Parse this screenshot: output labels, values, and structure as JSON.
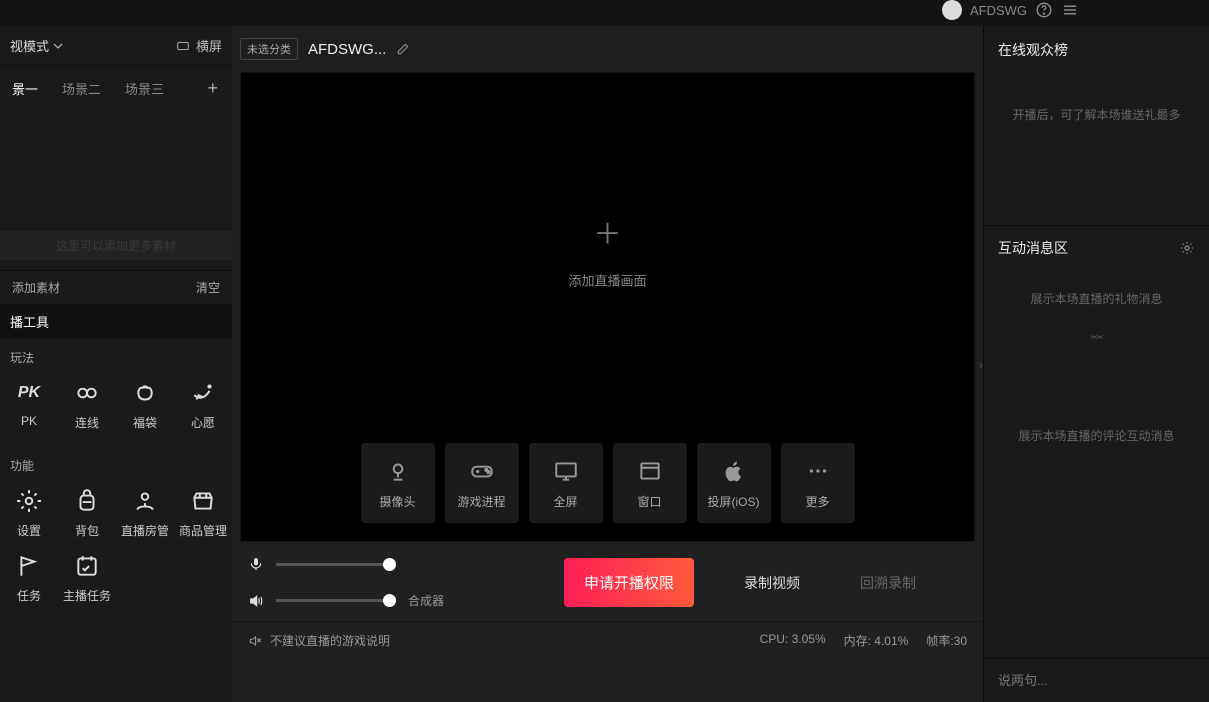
{
  "topbar": {
    "username": "AFDSWG"
  },
  "sidebar": {
    "mode_label": "视模式",
    "orientation_label": "横屏",
    "scenes": [
      "景一",
      "场景二",
      "场景三"
    ],
    "material_hint": "这里可以添加更多素材",
    "add_material_label": "添加素材",
    "clear_label": "清空",
    "tools_header": "播工具",
    "gameplay_header": "玩法",
    "gameplay": [
      {
        "id": "pk",
        "label": "PK"
      },
      {
        "id": "link",
        "label": "连线"
      },
      {
        "id": "lucky",
        "label": "福袋"
      },
      {
        "id": "wish",
        "label": "心愿"
      }
    ],
    "features_header": "功能",
    "features": [
      {
        "id": "settings",
        "label": "设置"
      },
      {
        "id": "backpack",
        "label": "背包"
      },
      {
        "id": "room-admin",
        "label": "直播房管"
      },
      {
        "id": "goods",
        "label": "商品管理"
      },
      {
        "id": "task1",
        "label": "任务"
      },
      {
        "id": "host-task",
        "label": "主播任务"
      }
    ]
  },
  "middle": {
    "category_tag": "未选分类",
    "title": "AFDSWG...",
    "add_preview_label": "添加直播画面",
    "sources": [
      {
        "id": "camera",
        "label": "摄像头"
      },
      {
        "id": "game",
        "label": "游戏进程"
      },
      {
        "id": "fullscreen",
        "label": "全屏"
      },
      {
        "id": "window",
        "label": "窗口"
      },
      {
        "id": "ios",
        "label": "投屏(iOS)"
      },
      {
        "id": "more",
        "label": "更多"
      }
    ],
    "synth_label": "合成器",
    "start_button": "申请开播权限",
    "record_label": "录制视频",
    "replay_label": "回溯录制",
    "advice_label": "不建议直播的游戏说明",
    "cpu_label": "CPU: 3.05%",
    "mem_label": "内存: 4.01%",
    "fps_label": "帧率:30"
  },
  "right": {
    "audience_title": "在线观众榜",
    "audience_empty": "开播后，可了解本场谁送礼最多",
    "interact_title": "互动消息区",
    "gift_empty": "展示本场直播的礼物消息",
    "comment_empty": "展示本场直播的评论互动消息",
    "chat_placeholder": "说两句..."
  }
}
